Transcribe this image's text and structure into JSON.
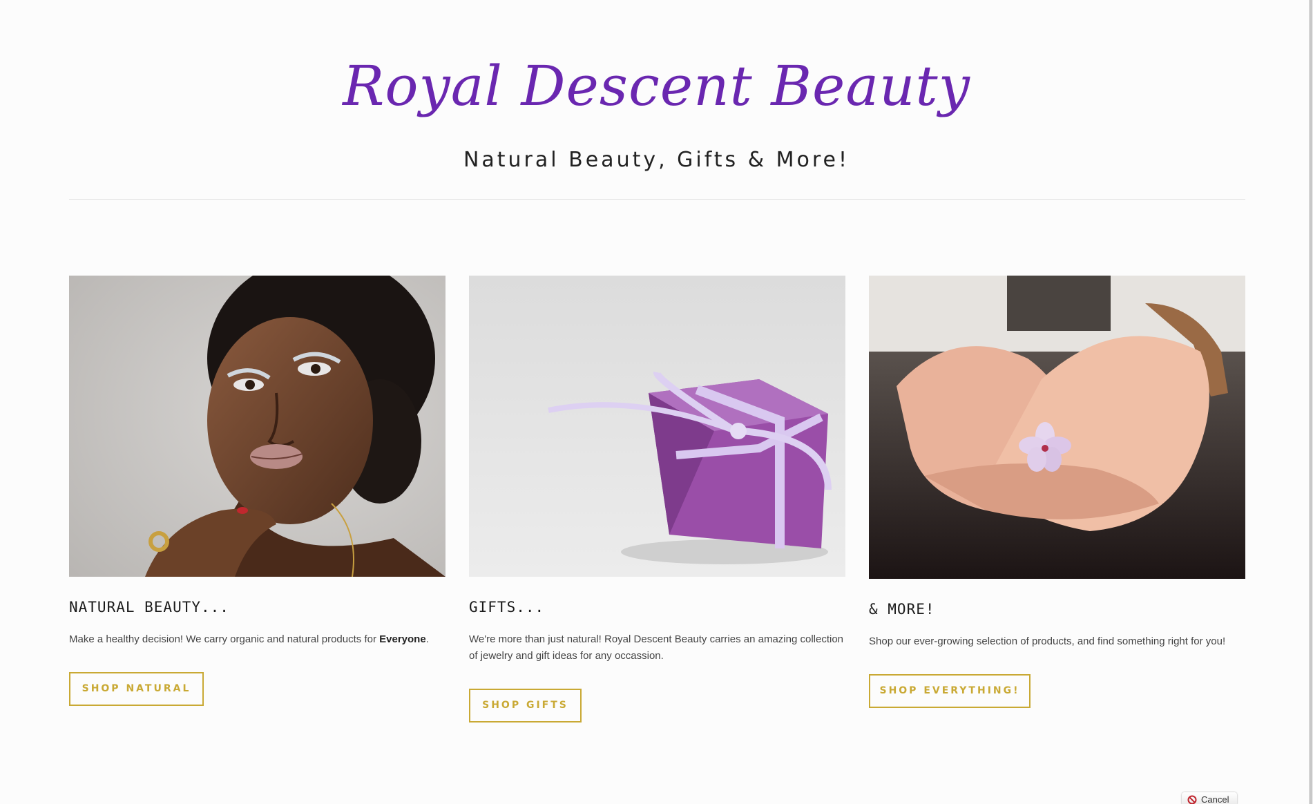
{
  "header": {
    "title": "Royal Descent Beauty",
    "tagline": "Natural Beauty, Gifts & More!"
  },
  "cards": [
    {
      "image_icon": "woman-portrait-image",
      "title": "NATURAL BEAUTY...",
      "text_before": "Make  a healthy decision!  We carry organic and natural products for ",
      "text_bold": "Everyone",
      "text_after": ".",
      "button_label": "SHOP NATURAL"
    },
    {
      "image_icon": "purple-gift-box-image",
      "title": "GIFTS...",
      "text": "We're more than just natural!  Royal Descent Beauty carries an amazing collection of jewelry and gift ideas for any occassion.",
      "button_label": "SHOP GIFTS"
    },
    {
      "image_icon": "hands-holding-flower-image",
      "title": "& MORE!",
      "text": "Shop our ever-growing selection of products, and find something right for you!",
      "button_label": "SHOP EVERYTHING!"
    }
  ],
  "overlay": {
    "cancel_label": "Cancel"
  },
  "colors": {
    "brand_purple": "#6a27b0",
    "button_gold": "#c9a934",
    "background": "#fcfcfc"
  }
}
